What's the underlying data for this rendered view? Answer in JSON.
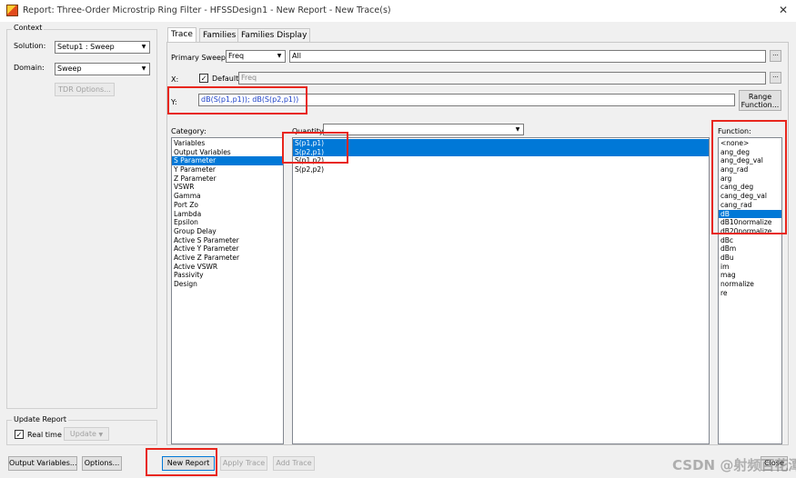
{
  "window": {
    "title": "Report: Three-Order Microstrip Ring Filter - HFSSDesign1 - New Report - New Trace(s)",
    "close_glyph": "✕"
  },
  "context": {
    "group_label": "Context",
    "solution_label": "Solution:",
    "solution_value": "Setup1 : Sweep",
    "domain_label": "Domain:",
    "domain_value": "Sweep",
    "tdr_button": "TDR Options..."
  },
  "update_report": {
    "group_label": "Update Report",
    "realtime_label": "Real time",
    "realtime_checked": true,
    "update_button": "Update"
  },
  "tabs": [
    {
      "label": "Trace",
      "active": true
    },
    {
      "label": "Families",
      "active": false
    },
    {
      "label": "Families Display",
      "active": false
    }
  ],
  "primary_sweep": {
    "label": "Primary Sweep:",
    "value": "Freq",
    "all_value": "All",
    "ellipsis": "..."
  },
  "x_axis": {
    "label": "X:",
    "default_label": "Default",
    "default_checked": true,
    "value": "Freq",
    "ellipsis": "..."
  },
  "y_axis": {
    "label": "Y:",
    "value": "dB(S(p1,p1)); dB(S(p2,p1))",
    "range_button_line1": "Range",
    "range_button_line2": "Function..."
  },
  "category": {
    "label": "Category:",
    "items": [
      "Variables",
      "Output Variables",
      "S Parameter",
      "Y Parameter",
      "Z Parameter",
      "VSWR",
      "Gamma",
      "Port Zo",
      "Lambda",
      "Epsilon",
      "Group Delay",
      "Active S Parameter",
      "Active Y Parameter",
      "Active Z Parameter",
      "Active VSWR",
      "Passivity",
      "Design"
    ],
    "selected": "S Parameter"
  },
  "quantity": {
    "label": "Quantity:",
    "filter_value": "",
    "items": [
      "S(p1,p1)",
      "S(p2,p1)",
      "S(p1,p2)",
      "S(p2,p2)"
    ],
    "selected": [
      "S(p1,p1)",
      "S(p2,p1)"
    ]
  },
  "function": {
    "label": "Function:",
    "items": [
      "<none>",
      "ang_deg",
      "ang_deg_val",
      "ang_rad",
      "arg",
      "cang_deg",
      "cang_deg_val",
      "cang_rad",
      "dB",
      "dB10normalize",
      "dB20normalize",
      "dBc",
      "dBm",
      "dBu",
      "im",
      "mag",
      "normalize",
      "re"
    ],
    "selected": "dB"
  },
  "bottom_buttons": {
    "output_variables": "Output Variables...",
    "options": "Options...",
    "new_report": "New Report",
    "apply_trace": "Apply Trace",
    "add_trace": "Add Trace",
    "close": "Close"
  },
  "watermark": "CSDN @射频百花潭",
  "colors": {
    "highlight": "#e8261d",
    "selection": "#0078d7",
    "y_text": "#1a3ec8"
  }
}
